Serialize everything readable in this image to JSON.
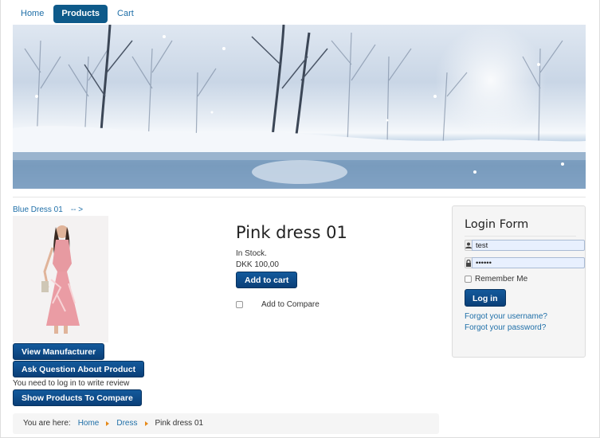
{
  "nav": {
    "items": [
      {
        "label": "Home",
        "active": false
      },
      {
        "label": "Products",
        "active": true
      },
      {
        "label": "Cart",
        "active": false
      }
    ]
  },
  "product_nav": {
    "prev": "Blue Dress 01",
    "next": "-- >"
  },
  "product": {
    "title": "Pink dress 01",
    "stock": "In Stock.",
    "price": "DKK 100,00",
    "add_to_cart": "Add to cart",
    "compare_label": "Add to Compare"
  },
  "buttons": {
    "view_manufacturer": "View Manufacturer",
    "ask_question": "Ask Question About Product",
    "show_compare": "Show Products To Compare"
  },
  "review_note": "You need to log in to write review",
  "breadcrumb": {
    "prefix": "You are here:",
    "items": [
      "Home",
      "Dress",
      "Pink dress 01"
    ]
  },
  "login": {
    "title": "Login Form",
    "username": "test",
    "password": "••••••",
    "remember": "Remember Me",
    "submit": "Log in",
    "forgot_username": "Forgot your username?",
    "forgot_password": "Forgot your password?",
    "icons": [
      "user-icon",
      "lock-icon"
    ]
  }
}
